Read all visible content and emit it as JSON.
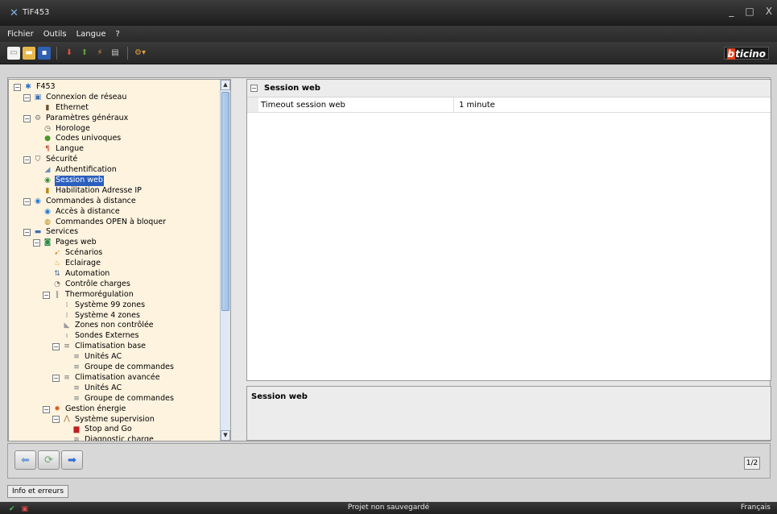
{
  "window": {
    "title": "TiF453",
    "icon": "x-logo-icon",
    "controls": [
      "_",
      "□",
      "X"
    ]
  },
  "menu": [
    "Fichier",
    "Outils",
    "Langue",
    "?"
  ],
  "toolbar": {
    "buttons": [
      "new-file-icon",
      "open-folder-icon",
      "save-icon",
      "download-icon",
      "upload-icon",
      "connect-icon",
      "device-icon",
      "settings-icon"
    ],
    "brand_prefix": "b",
    "brand_rest": "ticino"
  },
  "tree": {
    "nodes": [
      {
        "label": "F453",
        "level": 0,
        "exp": "−",
        "icon": "device-icon",
        "glyph": "✱",
        "color": "#2d6fd3"
      },
      {
        "label": "Connexion de réseau",
        "level": 1,
        "exp": "−",
        "icon": "network-icon",
        "glyph": "▣",
        "color": "#3a6fb8"
      },
      {
        "label": "Ethernet",
        "level": 2,
        "exp": "",
        "icon": "ethernet-icon",
        "glyph": "▮",
        "color": "#6a4b2a"
      },
      {
        "label": "Paramètres généraux",
        "level": 1,
        "exp": "−",
        "icon": "gears-icon",
        "glyph": "⚙",
        "color": "#777"
      },
      {
        "label": "Horologe",
        "level": 2,
        "exp": "",
        "icon": "clock-icon",
        "glyph": "◷",
        "color": "#666"
      },
      {
        "label": "Codes univoques",
        "level": 2,
        "exp": "",
        "icon": "codes-icon",
        "glyph": "●",
        "color": "#4a9a2a"
      },
      {
        "label": "Langue",
        "level": 2,
        "exp": "",
        "icon": "language-icon",
        "glyph": "¶",
        "color": "#c0492b"
      },
      {
        "label": "Sécurité",
        "level": 1,
        "exp": "−",
        "icon": "shield-icon",
        "glyph": "⛉",
        "color": "#555"
      },
      {
        "label": "Authentification",
        "level": 2,
        "exp": "",
        "icon": "key-icon",
        "glyph": "◢",
        "color": "#6a8fb8"
      },
      {
        "label": "Session web",
        "level": 2,
        "exp": "",
        "icon": "globe-icon",
        "glyph": "◉",
        "color": "#3b8b3b",
        "selected": true
      },
      {
        "label": "Habilitation Adresse IP",
        "level": 2,
        "exp": "",
        "icon": "ip-icon",
        "glyph": "▮",
        "color": "#b8860b"
      },
      {
        "label": "Commandes à distance",
        "level": 1,
        "exp": "−",
        "icon": "remote-icon",
        "glyph": "◉",
        "color": "#2a7ad0"
      },
      {
        "label": "Accès à distance",
        "level": 2,
        "exp": "",
        "icon": "globe-icon",
        "glyph": "◉",
        "color": "#2a7ad0"
      },
      {
        "label": "Commandes OPEN à bloquer",
        "level": 2,
        "exp": "",
        "icon": "lock-icon",
        "glyph": "◍",
        "color": "#b8860b"
      },
      {
        "label": "Services",
        "level": 1,
        "exp": "−",
        "icon": "services-icon",
        "glyph": "▬",
        "color": "#3a6fb8"
      },
      {
        "label": "Pages web",
        "level": 2,
        "exp": "−",
        "icon": "web-page-icon",
        "glyph": "◙",
        "color": "#2a8a4a"
      },
      {
        "label": "Scénarios",
        "level": 3,
        "exp": "",
        "icon": "scenario-icon",
        "glyph": "➹",
        "color": "#d89020"
      },
      {
        "label": "Eclairage",
        "level": 3,
        "exp": "",
        "icon": "light-icon",
        "glyph": "♨",
        "color": "#e0a020"
      },
      {
        "label": "Automation",
        "level": 3,
        "exp": "",
        "icon": "automation-icon",
        "glyph": "⇅",
        "color": "#4a6fa0"
      },
      {
        "label": "Contrôle charges",
        "level": 3,
        "exp": "",
        "icon": "load-control-icon",
        "glyph": "◔",
        "color": "#777"
      },
      {
        "label": "Thermorégulation",
        "level": 3,
        "exp": "−",
        "icon": "thermometer-icon",
        "glyph": "‖",
        "color": "#888"
      },
      {
        "label": "Système 99 zones",
        "level": 4,
        "exp": "",
        "icon": "zones-99-icon",
        "glyph": "⁞",
        "color": "#888"
      },
      {
        "label": "Système 4 zones",
        "level": 4,
        "exp": "",
        "icon": "zones-4-icon",
        "glyph": "⁞",
        "color": "#888"
      },
      {
        "label": "Zones non contrôlée",
        "level": 4,
        "exp": "",
        "icon": "zone-icon",
        "glyph": "◣",
        "color": "#999"
      },
      {
        "label": "Sondes Externes",
        "level": 4,
        "exp": "",
        "icon": "probe-icon",
        "glyph": "ı",
        "color": "#888"
      },
      {
        "label": "Climatisation base",
        "level": 4,
        "exp": "−",
        "icon": "ac-icon",
        "glyph": "≡",
        "color": "#777"
      },
      {
        "label": "Unités AC",
        "level": 5,
        "exp": "",
        "icon": "ac-unit-icon",
        "glyph": "≡",
        "color": "#777"
      },
      {
        "label": "Groupe de commandes",
        "level": 5,
        "exp": "",
        "icon": "command-group-icon",
        "glyph": "≡",
        "color": "#777"
      },
      {
        "label": "Climatisation avancée",
        "level": 4,
        "exp": "−",
        "icon": "ac-icon",
        "glyph": "≡",
        "color": "#777"
      },
      {
        "label": "Unités AC",
        "level": 5,
        "exp": "",
        "icon": "ac-unit-icon",
        "glyph": "≡",
        "color": "#777"
      },
      {
        "label": "Groupe de commandes",
        "level": 5,
        "exp": "",
        "icon": "command-group-icon",
        "glyph": "≡",
        "color": "#777"
      },
      {
        "label": "Gestion énergie",
        "level": 3,
        "exp": "−",
        "icon": "energy-icon",
        "glyph": "✸",
        "color": "#d06020"
      },
      {
        "label": "Système supervision",
        "level": 4,
        "exp": "−",
        "icon": "supervision-icon",
        "glyph": "⋀",
        "color": "#a07030"
      },
      {
        "label": "Stop and Go",
        "level": 5,
        "exp": "",
        "icon": "stop-go-icon",
        "glyph": "▆",
        "color": "#c02020"
      },
      {
        "label": "Diagnostic charge",
        "level": 5,
        "exp": "",
        "icon": "diagnostic-icon",
        "glyph": "≋",
        "color": "#777"
      }
    ]
  },
  "props": {
    "category": "Session web",
    "rows": [
      {
        "name": "Timeout session web",
        "value": "1 minute"
      }
    ]
  },
  "description": {
    "title": "Session web"
  },
  "nav": {
    "page": "1/2"
  },
  "info": {
    "tab": "Info et erreurs"
  },
  "status": {
    "center": "Projet non sauvegardé",
    "right": "Français"
  }
}
